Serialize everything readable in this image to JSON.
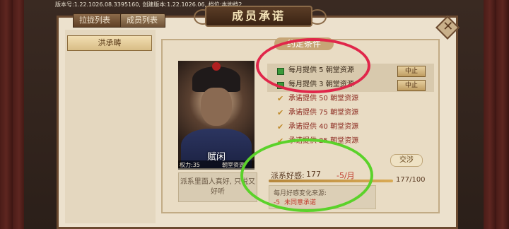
{
  "version_text": "版本号:1.22.1026.08.3395160, 创建版本:1.22.1026.06, 档位:本地档2",
  "tabs": [
    {
      "label": "拉拢列表"
    },
    {
      "label": "成员列表"
    }
  ],
  "title": "成员承诺",
  "close_icon": "close-x-icon",
  "left_panel": {
    "button_label": "洪承畴"
  },
  "character": {
    "name": "赋闲",
    "power_label": "权力:35",
    "resource_label": "朝堂资源",
    "description": "派系里面人真好, 只说又好听"
  },
  "conditions": {
    "header": "约定条件",
    "items": [
      {
        "text": "每月提供 5 朝堂资源",
        "active": true,
        "mark": "green-box-icon",
        "action_label": "中止"
      },
      {
        "text": "每月提供 3 朝堂资源",
        "active": true,
        "mark": "green-box-icon",
        "action_label": "中止"
      },
      {
        "text": "承诺提供 50 朝堂资源",
        "active": false,
        "mark": "check-icon"
      },
      {
        "text": "承诺提供 75 朝堂资源",
        "active": false,
        "mark": "check-icon"
      },
      {
        "text": "承诺提供 40 朝堂资源",
        "active": false,
        "mark": "check-icon"
      },
      {
        "text": "承诺提供 25 朝堂资源",
        "active": false,
        "mark": "check-icon"
      }
    ]
  },
  "negotiate_label": "交涉",
  "favor": {
    "label": "派系好感:",
    "value": "177",
    "change": "-5/月",
    "total": "177/100",
    "fill_fraction": 1.0
  },
  "source": {
    "title": "每月好感变化来源:",
    "items": [
      {
        "amount": "-5",
        "reason": "未同意承诺"
      }
    ]
  },
  "colors": {
    "panel": "#ece1cd",
    "annotation_red": "#e0264a",
    "annotation_green": "#5bd22a",
    "negative": "#c0392b"
  }
}
